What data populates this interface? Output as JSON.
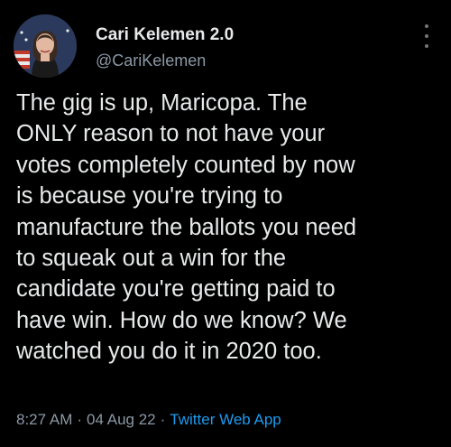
{
  "author": {
    "display_name": "Cari Kelemen 2.0",
    "handle": "@CariKelemen",
    "avatar_icon": "profile-photo-icon"
  },
  "more_icon": "more-options-icon",
  "tweet": {
    "lines": [
      "The gig is up, Maricopa. The",
      "ONLY reason to not have your",
      "votes completely counted by now",
      "is because you're trying to",
      "manufacture the ballots you need",
      "to squeak out a win for the",
      "candidate you're getting paid to",
      "have win. How do we know? We",
      "watched you do it in 2020 too."
    ]
  },
  "meta": {
    "time": "8:27 AM",
    "separator": "·",
    "date": "04 Aug 22",
    "source": "Twitter Web App"
  },
  "colors": {
    "background": "#000000",
    "primary_text": "#e7e9ea",
    "secondary_text": "#8b98a5",
    "link": "#1d9bf0"
  }
}
